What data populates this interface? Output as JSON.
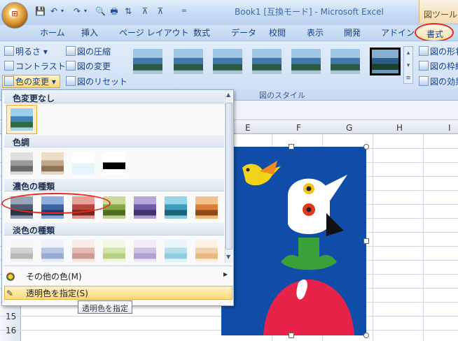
{
  "window": {
    "title": "Book1  [互換モード] - Microsoft Excel",
    "tool_context": "図ツール"
  },
  "quick_access": {
    "separator": "="
  },
  "tabs": [
    "ホーム",
    "挿入",
    "ページ レイアウト",
    "数式",
    "データ",
    "校閲",
    "表示",
    "開発",
    "アドイン"
  ],
  "active_tab": "書式",
  "ribbon": {
    "adjust": {
      "brightness": "明るさ",
      "contrast": "コントラスト",
      "recolor": "色の変更",
      "compress": "図の圧縮",
      "change": "図の変更",
      "reset": "図のリセット"
    },
    "styles_label": "図のスタイル",
    "right": {
      "shape": "図の形状",
      "border": "図の枠線",
      "effects": "図の効果"
    }
  },
  "dropdown": {
    "sections": [
      "色変更なし",
      "色調",
      "濃色の種類",
      "淡色の種類"
    ],
    "more_colors": "その他の色(M)",
    "set_transparent": "透明色を指定(S)"
  },
  "tooltip": "透明色を指定",
  "columns": [
    "E",
    "F",
    "G",
    "H",
    "I"
  ],
  "rows": [
    "15",
    "16"
  ],
  "colors": {
    "accent": "#e52a1c",
    "picture_bg": "#0f4da8"
  }
}
